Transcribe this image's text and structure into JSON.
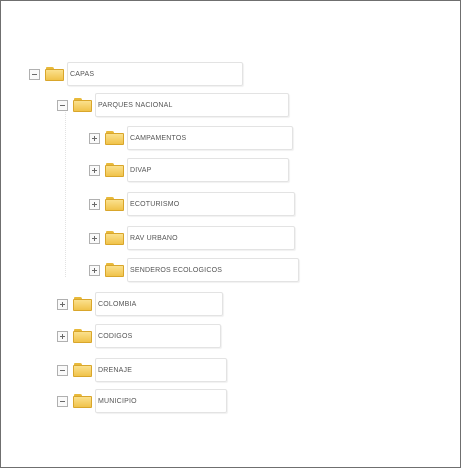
{
  "tree": {
    "root": {
      "label": "CAPAS",
      "expanded": true
    },
    "group1": {
      "label": "PARQUES NACIONAL",
      "expanded": true
    },
    "group1_children": [
      {
        "label": "CAMPAMENTOS",
        "toggle": "plus"
      },
      {
        "label": "DIVAP",
        "toggle": "plus"
      },
      {
        "label": "ECOTURISMO",
        "toggle": "plus"
      },
      {
        "label": "RAV URBANO",
        "toggle": "plus"
      },
      {
        "label": "SENDEROS ECOLOGICOS",
        "toggle": "plus"
      }
    ],
    "siblings": [
      {
        "label": "COLOMBIA",
        "toggle": "plus"
      },
      {
        "label": "CODIGOS",
        "toggle": "plus"
      },
      {
        "label": "DRENAJE",
        "toggle": "minus"
      },
      {
        "label": "MUNICIPIO",
        "toggle": "minus"
      }
    ]
  }
}
